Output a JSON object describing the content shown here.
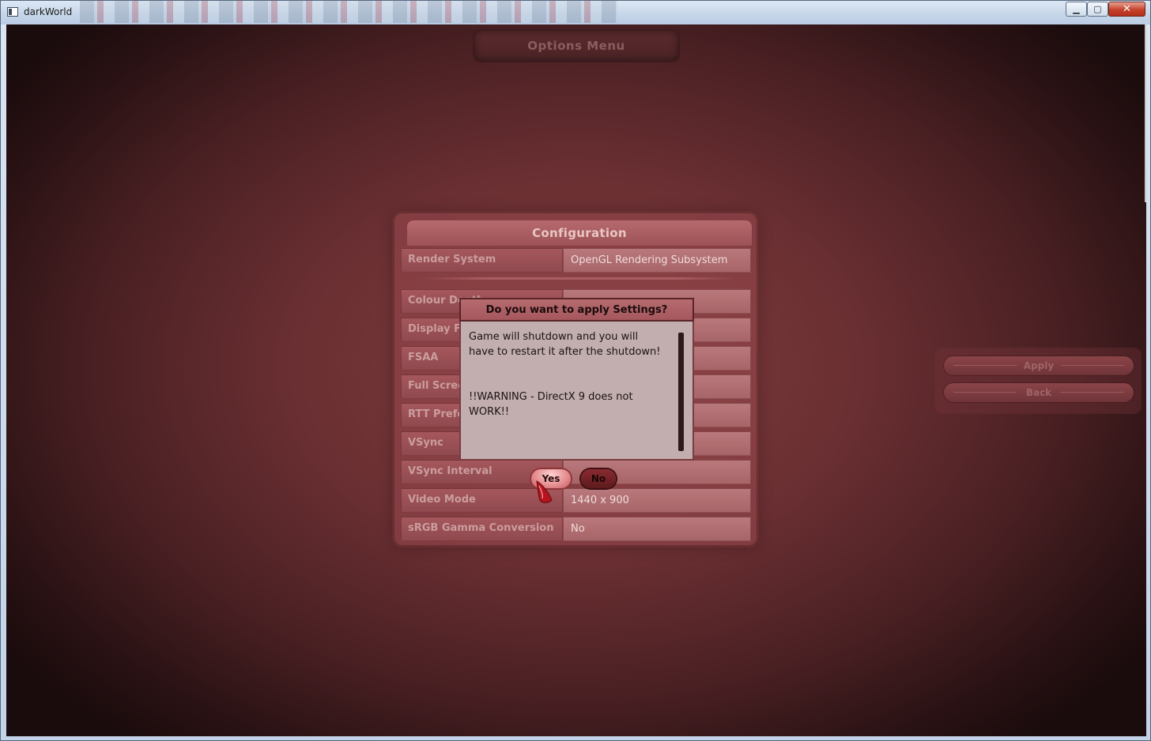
{
  "window": {
    "title": "darkWorld",
    "min_glyph": "▁",
    "max_glyph": "▢",
    "close_glyph": "✕"
  },
  "options_menu": {
    "title": "Options Menu"
  },
  "configuration": {
    "title": "Configuration",
    "rows": [
      {
        "label": "Render System",
        "value": "OpenGL Rendering Subsystem"
      },
      {
        "label": "Colour Depth",
        "value": ""
      },
      {
        "label": "Display Frequency",
        "value": ""
      },
      {
        "label": "FSAA",
        "value": ""
      },
      {
        "label": "Full Screen",
        "value": ""
      },
      {
        "label": "RTT Preferred Mode",
        "value": ""
      },
      {
        "label": "VSync",
        "value": ""
      },
      {
        "label": "VSync Interval",
        "value": ""
      },
      {
        "label": "Video Mode",
        "value": "1440 x 900"
      },
      {
        "label": "sRGB Gamma Conversion",
        "value": "No"
      }
    ]
  },
  "side_buttons": {
    "apply": "Apply",
    "back": "Back"
  },
  "dialog": {
    "title": "Do you want to apply Settings?",
    "message_line1": "Game will shutdown and you will",
    "message_line2": "have to restart it after the shutdown!",
    "warning_line1": " !!WARNING - DirectX 9 does not",
    "warning_line2": "WORK!!",
    "yes": "Yes",
    "no": "No"
  }
}
